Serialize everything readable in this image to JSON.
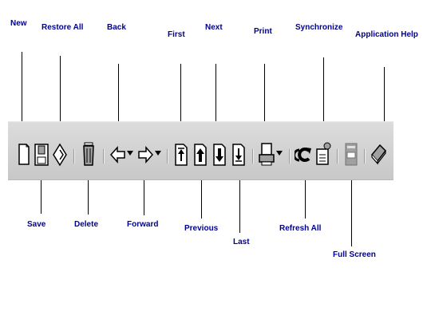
{
  "annotations": {
    "new": "New",
    "restore_all": "Restore All",
    "back": "Back",
    "first": "First",
    "next": "Next",
    "print": "Print",
    "synchronize": "Synchronize",
    "application_help": "Application Help",
    "save": "Save",
    "delete": "Delete",
    "forward": "Forward",
    "previous": "Previous",
    "last": "Last",
    "refresh_all": "Refresh All",
    "full_screen": "Full Screen"
  },
  "colors": {
    "label_text": "#000090",
    "toolbar_background": "#d2d2d2",
    "icon_outline": "#000000",
    "icon_fill": "#ffffff",
    "icon_shade": "#a0a0a0"
  },
  "toolbar_icons": [
    "new-document-icon",
    "save-icon",
    "restore-all-icon",
    "trash-icon",
    "back-arrow-icon",
    "forward-arrow-icon",
    "first-page-icon",
    "previous-page-icon",
    "next-page-icon",
    "last-page-icon",
    "printer-icon",
    "refresh-icon",
    "synchronize-icon",
    "full-screen-icon",
    "help-book-icon"
  ]
}
